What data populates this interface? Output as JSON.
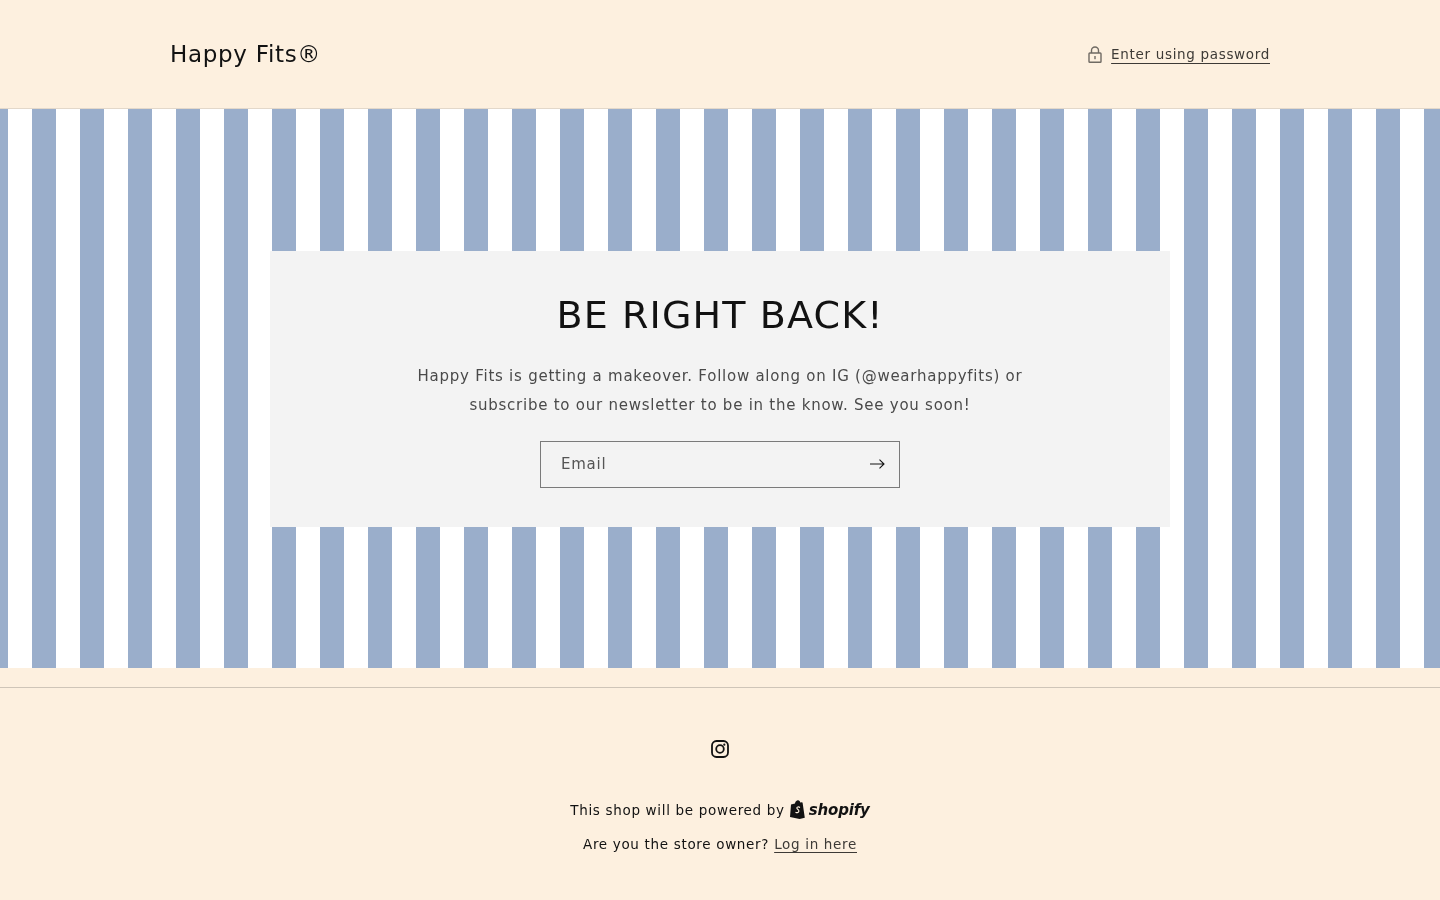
{
  "header": {
    "logo": "Happy Fits®",
    "password_link": "Enter using password"
  },
  "hero": {
    "heading": "BE RIGHT BACK!",
    "text": "Happy Fits is getting a makeover. Follow along on IG (@wearhappyfits) or subscribe to our newsletter to be in the know. See you soon!",
    "email_field": {
      "placeholder": "Email"
    }
  },
  "footer": {
    "powered_by": "This shop will be powered by",
    "brand": "shopify",
    "owner_question": "Are you the store owner?",
    "login_link": "Log in here"
  }
}
